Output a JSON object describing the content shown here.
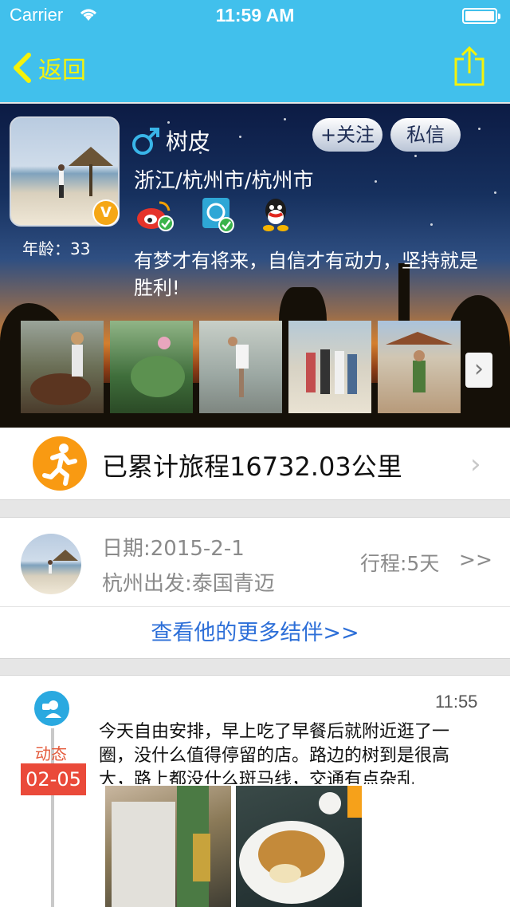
{
  "status_bar": {
    "carrier": "Carrier",
    "time": "11:59 AM"
  },
  "nav": {
    "back_label": "返回",
    "share_icon": "share-icon"
  },
  "profile": {
    "name": "树皮",
    "gender_icon": "male-icon",
    "location": "浙江/杭州市/杭州市",
    "age_label": "年龄：33",
    "vip_badge": "V",
    "follow_label": "+关注",
    "message_label": "私信",
    "motto": "有梦才有将来，自信才有动力，坚持就是胜利!",
    "verified_accounts": [
      "weibo-icon",
      "phone-verified-icon",
      "qq-icon"
    ],
    "photos": [
      "horse-riding",
      "lotus-leaves",
      "beach-starfish",
      "group-beach",
      "resort-beach"
    ]
  },
  "mileage": {
    "text": "已累计旅程16732.03公里"
  },
  "trip": {
    "date": "日期:2015-2-1",
    "route": "杭州出发:泰国青迈",
    "duration": "行程:5天",
    "arrow": ">>",
    "more_link": "查看他的更多结伴>>"
  },
  "feed": {
    "type_label": "动态",
    "date": "02-05",
    "time": "11:55",
    "text": "今天自由安排，早上吃了早餐后就附近逛了一圈，没什么值得停留的店。路边的树到是很高大，路上都没什么斑马线，交通有点杂乱"
  },
  "colors": {
    "nav_bg": "#41c0ec",
    "back_accent": "#f5f20a",
    "link": "#2d6fd8",
    "date_badge": "#ea4a3a"
  }
}
